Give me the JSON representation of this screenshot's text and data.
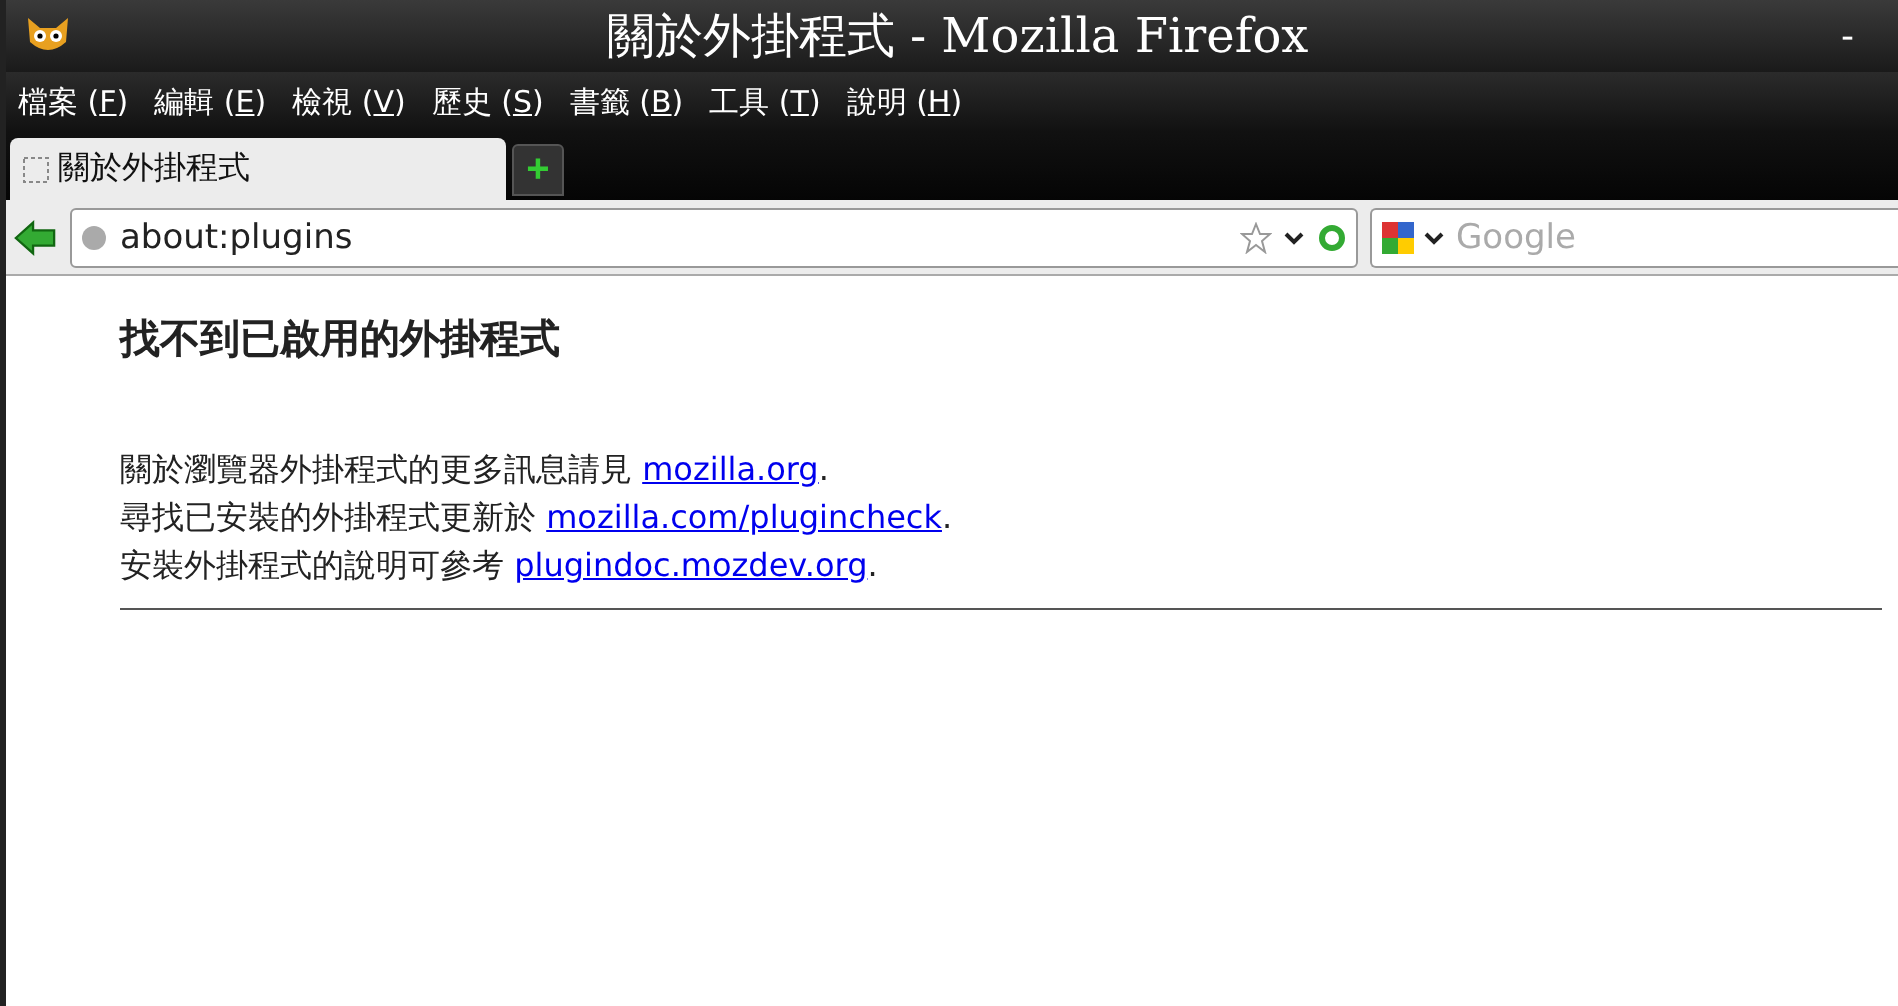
{
  "window": {
    "title": "關於外掛程式 - Mozilla Firefox",
    "minimize": "-"
  },
  "menu": [
    {
      "before": "檔案 (",
      "key": "F",
      "after": ")"
    },
    {
      "before": "編輯 (",
      "key": "E",
      "after": ")"
    },
    {
      "before": "檢視 (",
      "key": "V",
      "after": ")"
    },
    {
      "before": "歷史 (",
      "key": "S",
      "after": ")"
    },
    {
      "before": "書籤 (",
      "key": "B",
      "after": ")"
    },
    {
      "before": "工具 (",
      "key": "T",
      "after": ")"
    },
    {
      "before": "說明 (",
      "key": "H",
      "after": ")"
    }
  ],
  "tabs": [
    {
      "label": "關於外掛程式",
      "selected": true
    }
  ],
  "new_tab": "+",
  "address_bar": {
    "value": "about:plugins"
  },
  "search": {
    "placeholder": "Google"
  },
  "page": {
    "heading": "找不到已啟用的外掛程式",
    "lines": [
      {
        "text": "關於瀏覽器外掛程式的更多訊息請見 ",
        "link": "mozilla.org",
        "after": "."
      },
      {
        "text": "尋找已安裝的外掛程式更新於 ",
        "link": "mozilla.com/plugincheck",
        "after": "."
      },
      {
        "text": "安裝外掛程式的說明可參考 ",
        "link": "plugindoc.mozdev.org",
        "after": "."
      }
    ]
  }
}
